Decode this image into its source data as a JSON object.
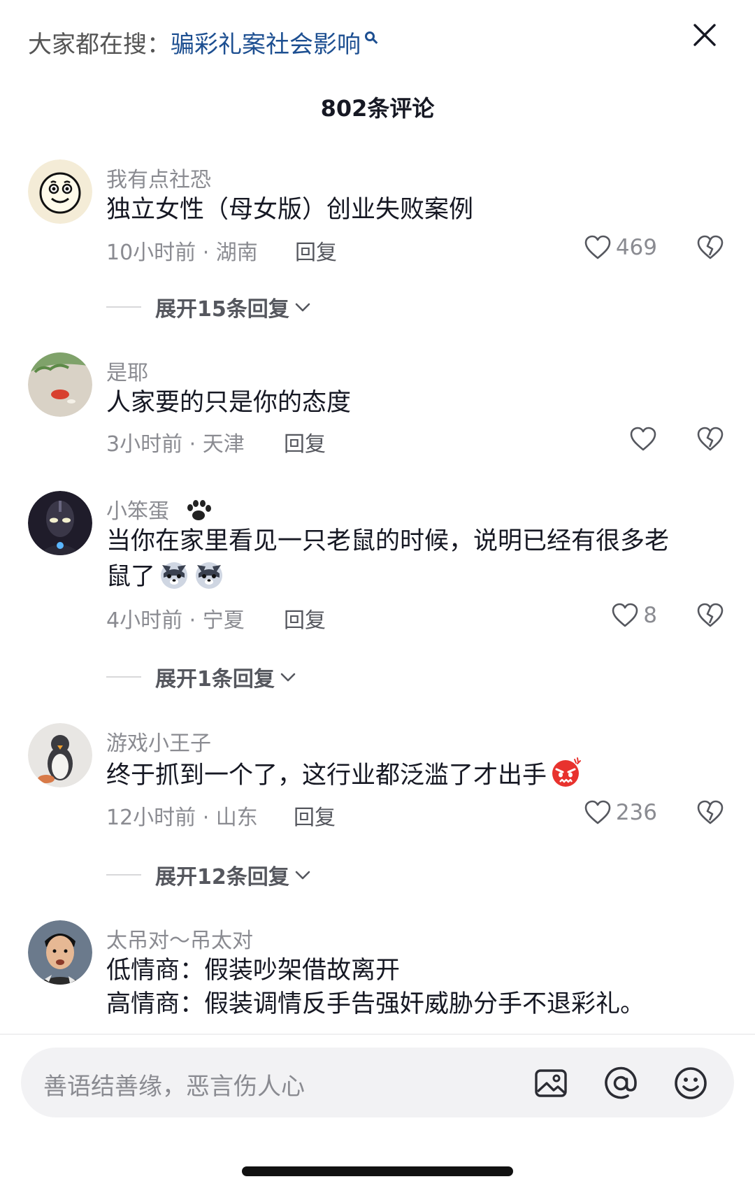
{
  "header": {
    "search_prefix": "大家都在搜：",
    "search_keyword": "骗彩礼案社会影响",
    "comment_count_title": "802条评论"
  },
  "comments": [
    {
      "user": "我有点社恐",
      "text": "独立女性（母女版）创业失败案例",
      "meta": "10小时前 · 湖南",
      "reply_label": "回复",
      "likes": "469",
      "expand_label": "展开15条回复"
    },
    {
      "user": "是耶",
      "text": "人家要的只是你的态度",
      "meta": "3小时前 · 天津",
      "reply_label": "回复",
      "likes": ""
    },
    {
      "user": "小笨蛋",
      "text_line1": "当你在家里看见一只老鼠的时候，说明已经有很多老",
      "text_line2": "鼠了",
      "meta": "4小时前 · 宁夏",
      "reply_label": "回复",
      "likes": "8",
      "expand_label": "展开1条回复"
    },
    {
      "user": "游戏小王子",
      "text": "终于抓到一个了，这行业都泛滥了才出手",
      "meta": "12小时前 · 山东",
      "reply_label": "回复",
      "likes": "236",
      "expand_label": "展开12条回复"
    },
    {
      "user": "太吊对～吊太对",
      "text_line1": "低情商：假装吵架借故离开",
      "text_line2": "高情商：假装调情反手告强奸威胁分手不退彩礼。"
    }
  ],
  "input": {
    "placeholder": "善语结善缘，恶言伤人心"
  },
  "icons": {
    "close": "close-icon",
    "heart": "heart-icon",
    "dislike": "broken-heart-icon",
    "image": "image-icon",
    "mention": "at-icon",
    "emoji": "smiley-icon"
  },
  "colors": {
    "keyword": "#1d4f91",
    "secondary_text": "#8a8b91",
    "primary_text": "#161823"
  }
}
